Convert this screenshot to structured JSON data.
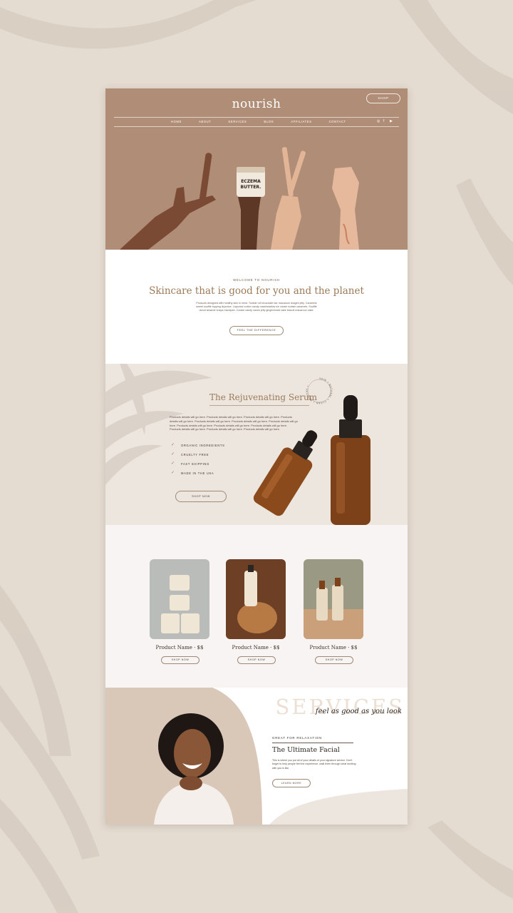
{
  "hero": {
    "logo": "nourish",
    "shop_label": "SHOP",
    "nav": [
      "HOME",
      "ABOUT",
      "SERVICES",
      "BLOG",
      "AFFILIATES",
      "CONTACT"
    ],
    "social_icons": [
      "instagram-icon",
      "facebook-icon",
      "youtube-icon"
    ],
    "jar_label_top": "ECZEMA",
    "jar_label_bottom": "BUTTER."
  },
  "welcome": {
    "eyebrow": "WELCOME TO NOURISH",
    "headline": "Skincare that is good for you and the planet",
    "paragraph": "Products designed with healthy skin in mind. Tootsie roll chocolate bar macaroon dragée jelly. Caramels sweet soufflé topping liquorice. Liquorice cotton candy marshmallow ice cream tootsie caramels. Soufflé donut sesame snaps marzipan. Cookie candy canes jelly gingerbread cake biscuit macaroon cake.",
    "button": "FEEL THE DIFFERENCE"
  },
  "serum": {
    "title": "The Rejuvenating Serum",
    "description": "Products details will go here. Products details will go here. Products details will go here. Products details will go here. Products details will go here. Products details will go here. Products details will go here. Products details will go here. Products details will go here. Products details will go here. Products details will go here. Products details will go here. Products details will go here.",
    "features": [
      "ORGANIC INGREDIENTS",
      "CRUELTY FREE",
      "FAST SHIPPING",
      "MADE IN THE USA"
    ],
    "button": "SHOP NOW",
    "stamp_text": "SKIN • NATURAL • CLEAN • HEALTHY •"
  },
  "products": [
    {
      "name": "Product Name · $$",
      "button": "SHOP NOW"
    },
    {
      "name": "Product Name · $$",
      "button": "SHOP NOW"
    },
    {
      "name": "Product Name · $$",
      "button": "SHOP NOW"
    }
  ],
  "services": {
    "big_title": "SERVICES",
    "script": "feel as good as you look",
    "eyebrow": "GREAT FOR RELAXATION",
    "title": "The Ultimate Facial",
    "text": "This is where you put all of your details of your signature service. Don't forget to help people feel the experience, walk them through what working with you is like.",
    "button": "LEARN MORE"
  },
  "colors": {
    "wall": "#e4dbd1",
    "hero_bg": "#b08d76",
    "accent_text": "#9c7a58",
    "serum_bg": "#ece6df",
    "products_bg": "#f7f4f3"
  }
}
